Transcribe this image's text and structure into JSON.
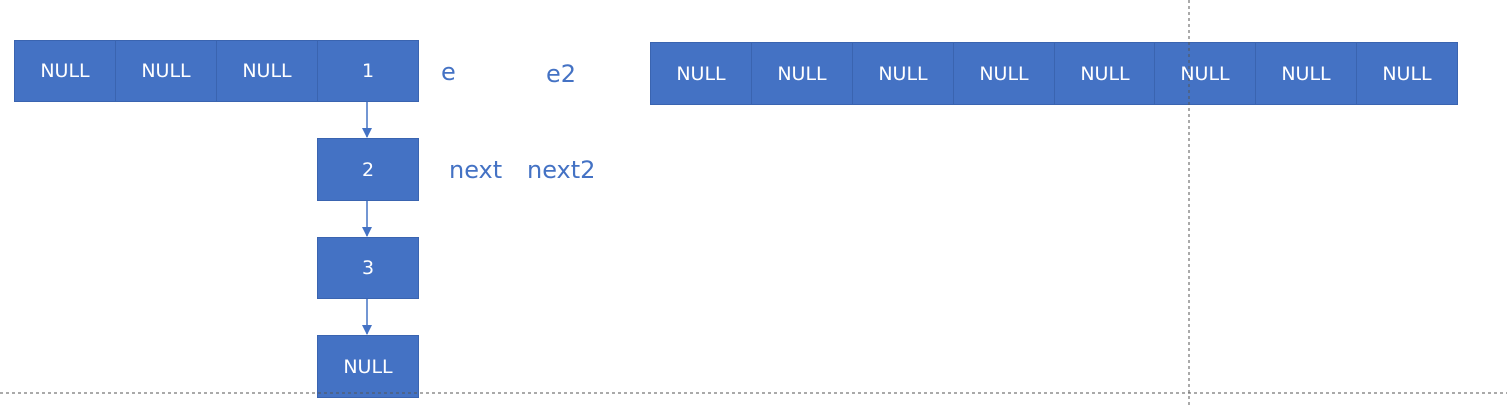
{
  "array_e": {
    "cells": [
      "NULL",
      "NULL",
      "NULL",
      "1"
    ]
  },
  "chain": {
    "nodes": [
      "2",
      "3",
      "NULL"
    ]
  },
  "array_e2": {
    "cells": [
      "NULL",
      "NULL",
      "NULL",
      "NULL",
      "NULL",
      "NULL",
      "NULL",
      "NULL"
    ]
  },
  "labels": {
    "e": "e",
    "e2": "e2",
    "next": "next",
    "next2": "next2"
  },
  "colors": {
    "cell_fill": "#4472c4",
    "cell_text": "#ffffff",
    "label_text": "#4472c4",
    "arrow": "#4472c4",
    "guide_line": "#555555"
  }
}
